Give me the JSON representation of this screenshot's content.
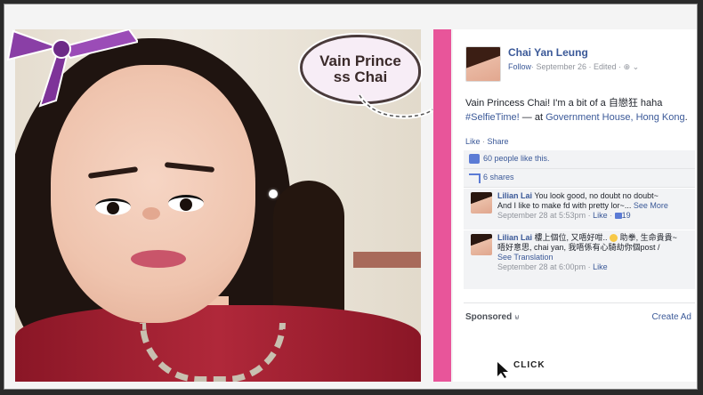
{
  "sticker": {
    "text_line1": "Vain Prince",
    "text_line2": "ss Chai"
  },
  "post": {
    "author": "Chai Yan Leung",
    "follow": "Follow",
    "meta": "· September 26 · Edited · ",
    "text_main": "Vain Princess Chai! I'm a bit of a 自戀狂 haha",
    "hashtag": "#SelfieTime!",
    "location_prefix": " — at ",
    "location": "Government House, Hong Kong",
    "like_link": "Like",
    "share_link": "Share",
    "likes_count": "60 people like this.",
    "shares_count": "6 shares"
  },
  "comments": [
    {
      "name": "Lilian Lai",
      "text1": "You look good, no doubt no doubt~",
      "text2": "And I like to make fd with pretty lor~...",
      "see_more": "See More",
      "time": "September 28 at 5:53pm",
      "like": "Like",
      "likes": "19"
    },
    {
      "name": "Lilian Lai",
      "text1": "樓上個位, 又唔好咁..",
      "text1b": "助拳, 生命貴貴~",
      "text2": "唔好意思, chai yan, 我唔係有心騎劫你個post /",
      "see_translation": "See Translation",
      "time": "September 28 at 6:00pm",
      "like": "Like"
    }
  ],
  "sidebar": {
    "sponsored": "Sponsored",
    "create_ad": "Create Ad"
  },
  "watermark": {
    "text": "CLICK"
  },
  "colors": {
    "pink_divider": "#e8559a",
    "fb_blue": "#3b5998",
    "shirt": "#b0283a"
  }
}
